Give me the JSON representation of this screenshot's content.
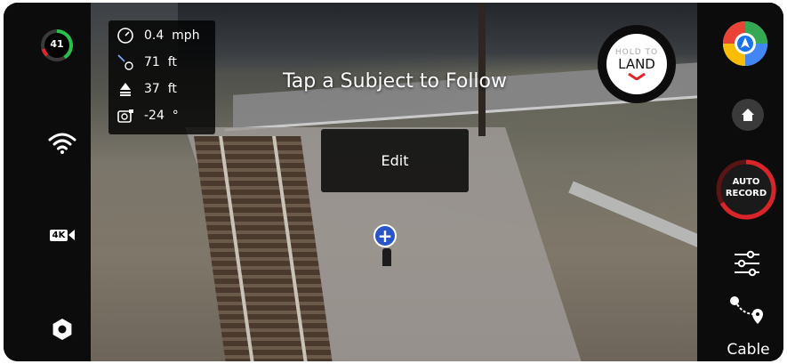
{
  "status": {
    "battery_level": "41",
    "battery_fraction": 0.41,
    "video_resolution": "4K"
  },
  "telemetry": {
    "speed_value": "0.4",
    "speed_unit": "mph",
    "distance_value": "71",
    "distance_unit": "ft",
    "altitude_value": "37",
    "altitude_unit": "ft",
    "gimbal_value": "-24",
    "gimbal_unit": "°"
  },
  "overlay": {
    "prompt": "Tap a Subject to Follow",
    "edit_label": "Edit",
    "subject_marker": "+"
  },
  "land_button": {
    "hold_label": "HOLD TO",
    "land_label": "LAND"
  },
  "right_panel": {
    "auto_record_line1": "AUTO",
    "auto_record_line2": "RECORD",
    "cable_label": "Cable"
  },
  "colors": {
    "battery_green": "#27c04a",
    "battery_red": "#e0262b",
    "record_red": "#d9252a",
    "subject_blue": "#2855c7",
    "panel_bg": "#0c0c0c"
  },
  "icons": [
    "battery-icon",
    "wifi-icon",
    "resolution-icon",
    "settings-icon",
    "speedometer-icon",
    "distance-icon",
    "altitude-icon",
    "gimbal-icon",
    "maps-icon",
    "home-icon",
    "auto-record-icon",
    "sliders-icon",
    "cable-icon"
  ]
}
